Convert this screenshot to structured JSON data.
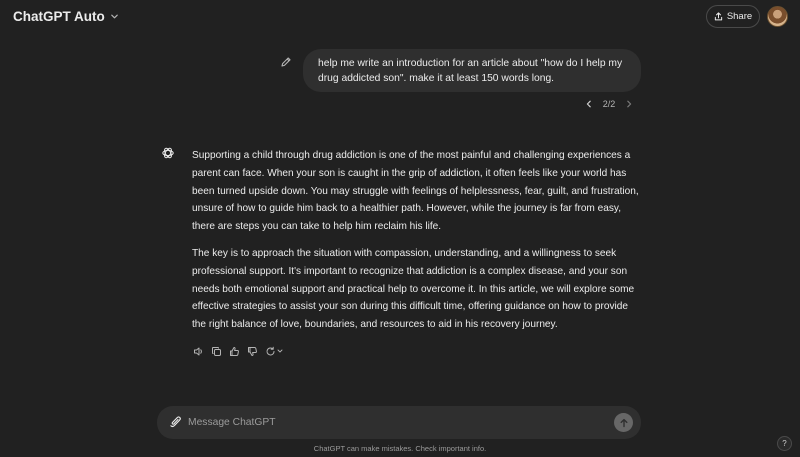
{
  "header": {
    "model_name": "ChatGPT Auto",
    "share_label": "Share"
  },
  "user_message": {
    "text": "help me write an introduction for an article about \"how do I help my drug addicted son\". make it at least 150 words long."
  },
  "pager": {
    "text": "2/2"
  },
  "assistant_message": {
    "paragraphs": [
      "Supporting a child through drug addiction is one of the most painful and challenging experiences a parent can face. When your son is caught in the grip of addiction, it often feels like your world has been turned upside down. You may struggle with feelings of helplessness, fear, guilt, and frustration, unsure of how to guide him back to a healthier path. However, while the journey is far from easy, there are steps you can take to help him reclaim his life.",
      "The key is to approach the situation with compassion, understanding, and a willingness to seek professional support. It's important to recognize that addiction is a complex disease, and your son needs both emotional support and practical help to overcome it. In this article, we will explore some effective strategies to assist your son during this difficult time, offering guidance on how to provide the right balance of love, boundaries, and resources to aid in his recovery journey."
    ]
  },
  "composer": {
    "placeholder": "Message ChatGPT",
    "value": ""
  },
  "footer": {
    "disclaimer": "ChatGPT can make mistakes. Check important info.",
    "help_label": "?"
  }
}
